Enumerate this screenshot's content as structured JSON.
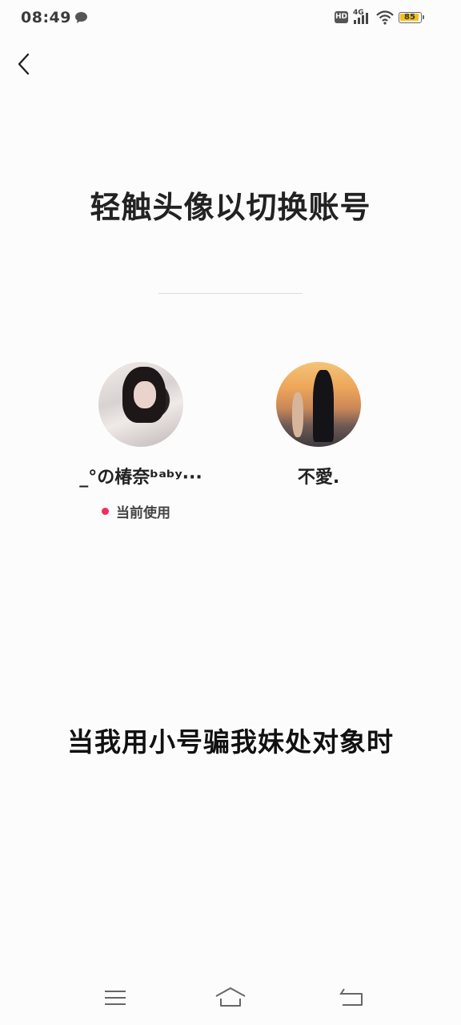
{
  "status_bar": {
    "time": "08:49",
    "network": "4G",
    "hd_label": "HD",
    "battery": "85"
  },
  "header": {
    "back_icon": "chevron-left-icon"
  },
  "main": {
    "title": "轻触头像以切换账号",
    "accounts": [
      {
        "name": "_°の椿奈ᵇᵃᵇʸ···",
        "status": "当前使用",
        "current": true
      },
      {
        "name": "不愛.",
        "current": false
      }
    ]
  },
  "overlay_caption": "当我用小号骗我妹处对象时",
  "nav_bar": {
    "menu_icon": "menu-icon",
    "home_icon": "home-icon",
    "back_icon": "back-arrow-icon"
  },
  "colors": {
    "current_dot": "#ef2f5e",
    "battery_fill": "#f2c21b"
  }
}
